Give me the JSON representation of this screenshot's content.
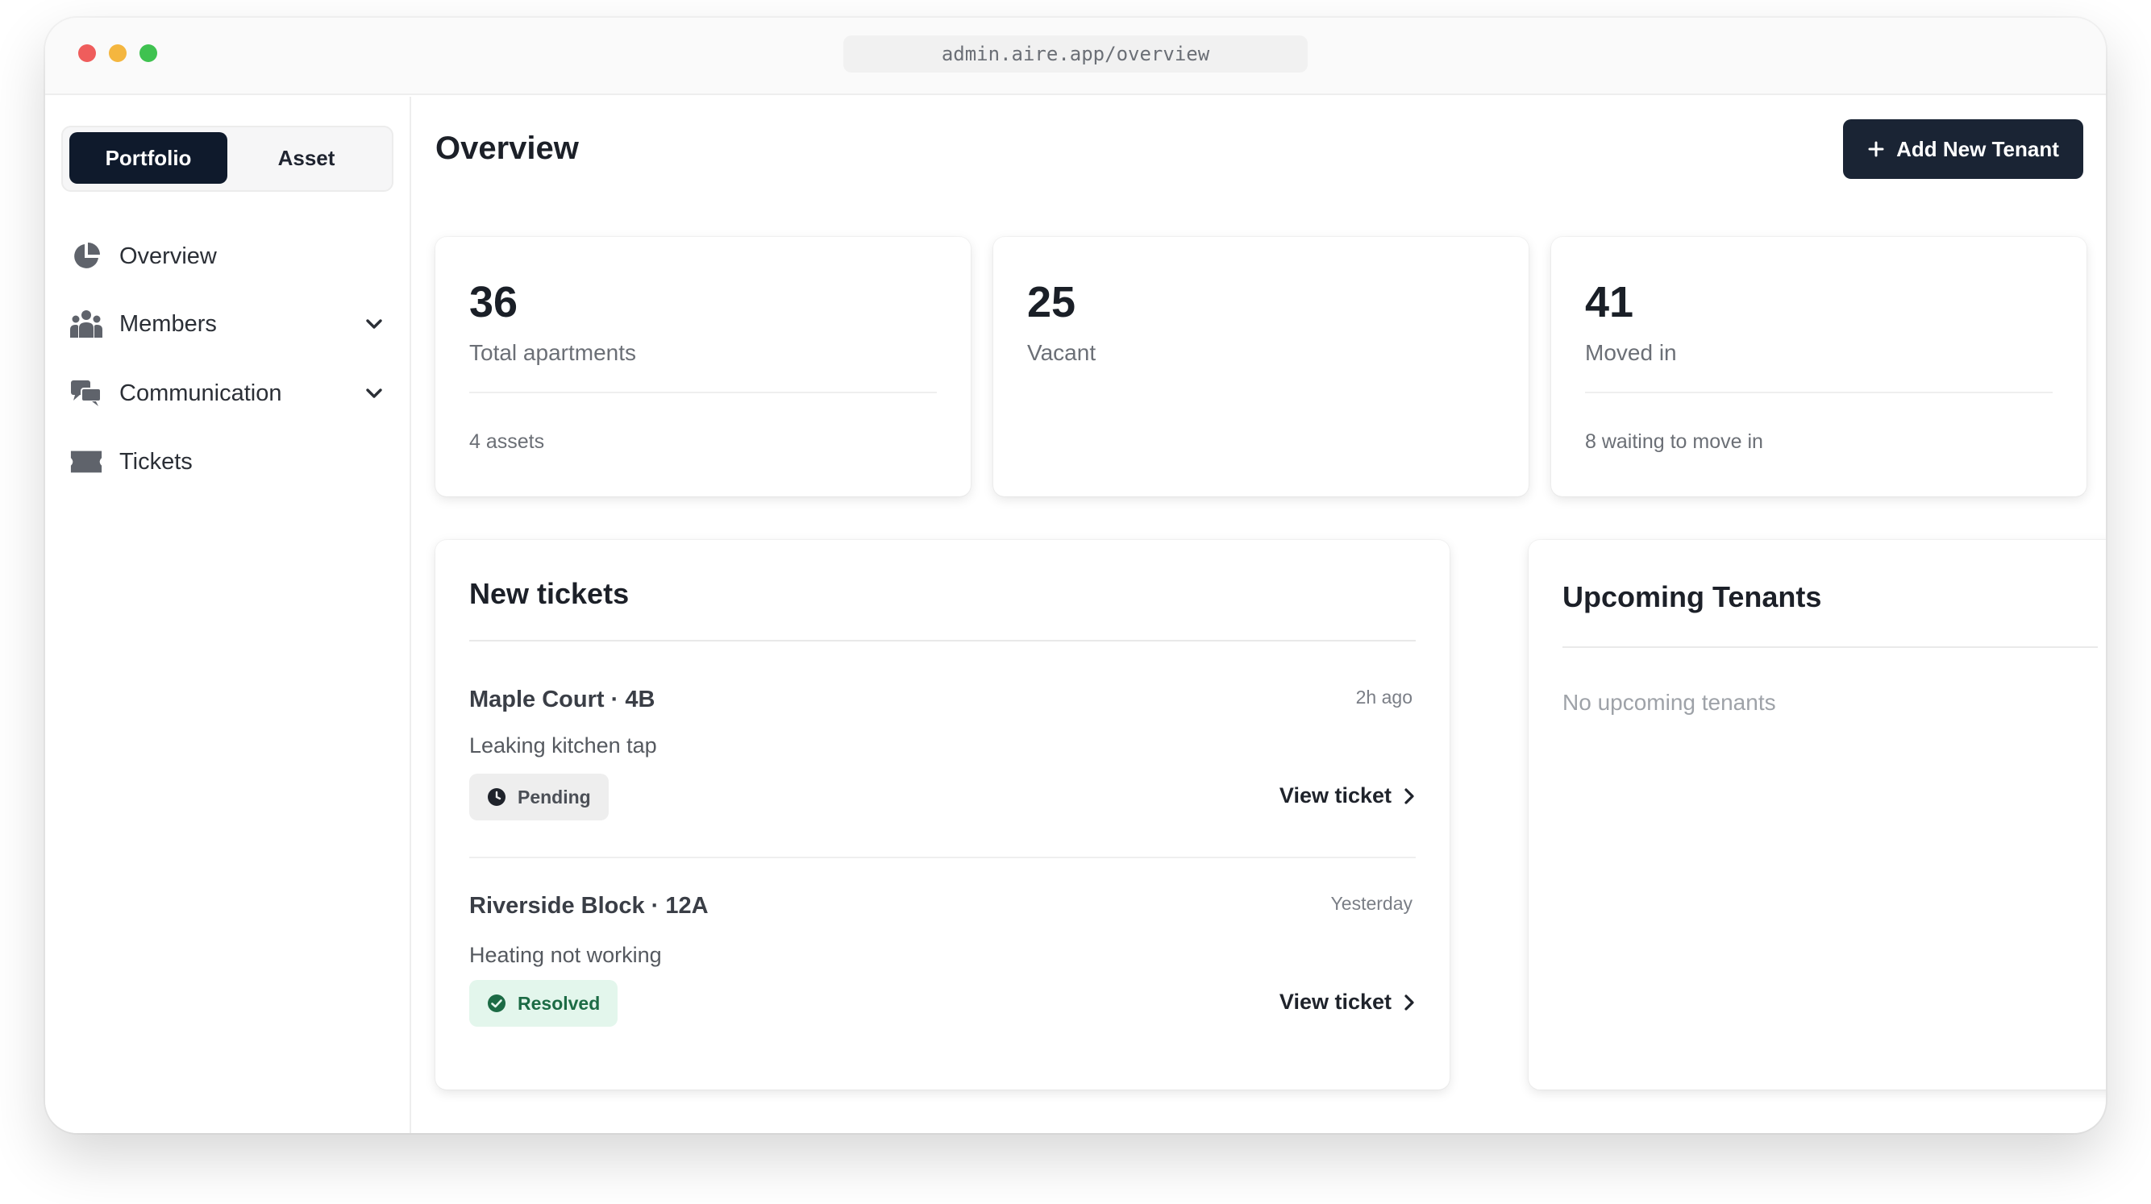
{
  "browser": {
    "url": "admin.aire.app/overview"
  },
  "sidebar": {
    "segments": [
      {
        "label": "Portfolio",
        "active": true
      },
      {
        "label": "Asset",
        "active": false
      }
    ],
    "items": [
      {
        "label": "Overview",
        "icon": "pie-chart-icon",
        "has_chevron": false
      },
      {
        "label": "Members",
        "icon": "users-icon",
        "has_chevron": true
      },
      {
        "label": "Communication",
        "icon": "chat-icon",
        "has_chevron": true
      },
      {
        "label": "Tickets",
        "icon": "ticket-icon",
        "has_chevron": false
      }
    ]
  },
  "header": {
    "title": "Overview",
    "add_button_label": "Add New Tenant"
  },
  "stats": [
    {
      "value": "36",
      "label": "Total apartments",
      "footer": "4 assets"
    },
    {
      "value": "25",
      "label": "Vacant",
      "footer": ""
    },
    {
      "value": "41",
      "label": "Moved in",
      "footer": "8 waiting to move in"
    }
  ],
  "tickets": {
    "title": "New tickets",
    "items": [
      {
        "location": "Maple Court · 4B",
        "time": "2h ago",
        "description": "Leaking kitchen tap",
        "status": "Pending",
        "status_color": "#eeeeee",
        "action": "View ticket"
      },
      {
        "location": "Riverside Block · 12A",
        "time": "Yesterday",
        "description": "Heating not working",
        "status": "Resolved",
        "status_color": "#e3f6ec",
        "action": "View ticket"
      }
    ]
  },
  "upcoming": {
    "title": "Upcoming Tenants",
    "empty_text": "No upcoming tenants"
  },
  "colors": {
    "primary_dark": "#0f1a2c",
    "button_dark": "#1a2434",
    "resolved_green": "#1c6b45"
  }
}
